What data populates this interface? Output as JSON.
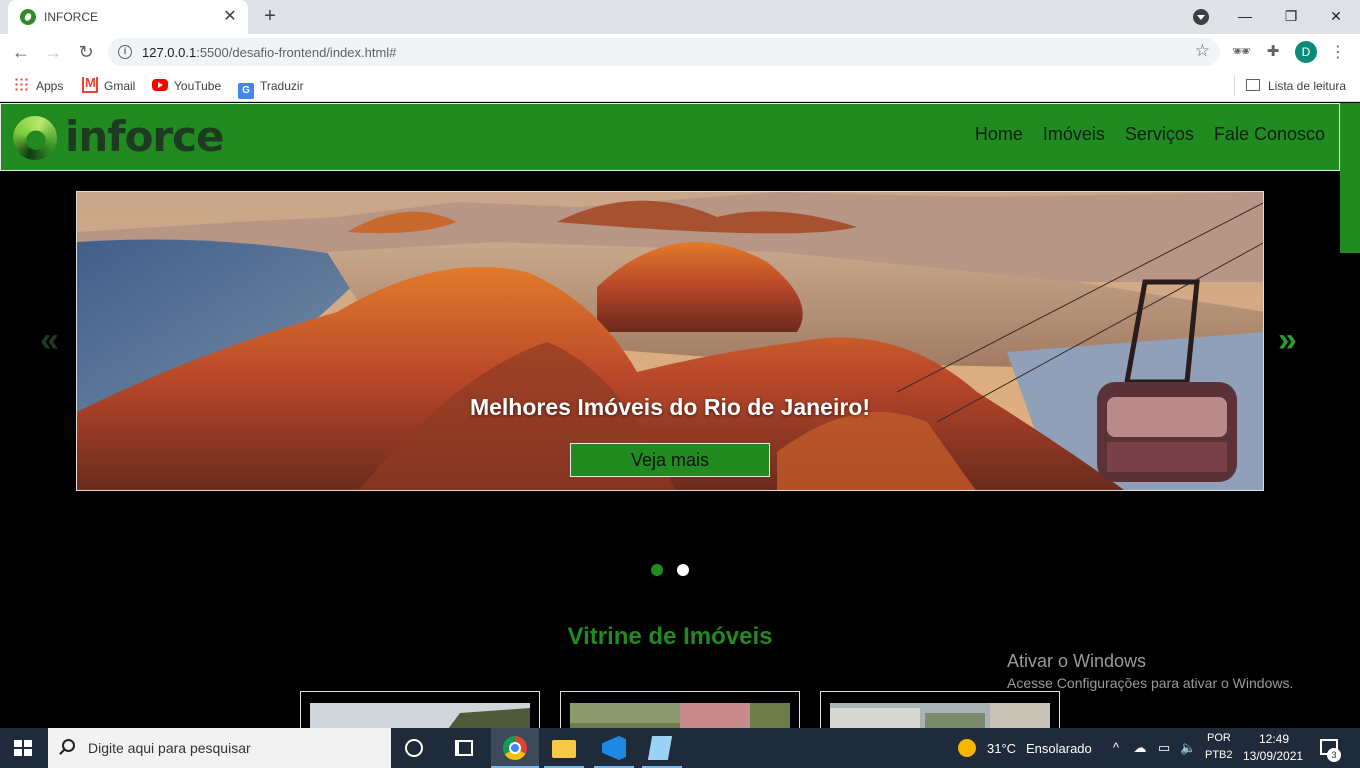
{
  "browser": {
    "tab_title": "INFORCE",
    "tab_close": "✕",
    "new_tab": "+",
    "url_host": "127.0.0.1",
    "url_path": ":5500/desafio-frontend/index.html#",
    "window_minimize": "—",
    "window_restore": "❐",
    "window_close": "✕",
    "profile_initial": "D",
    "bookmarks": [
      {
        "label": "Apps"
      },
      {
        "label": "Gmail"
      },
      {
        "label": "YouTube"
      },
      {
        "label": "Traduzir"
      }
    ],
    "reading_list": "Lista de leitura"
  },
  "site": {
    "logo_text": "inforce",
    "nav": [
      {
        "label": "Home"
      },
      {
        "label": "Imóveis"
      },
      {
        "label": "Serviços"
      },
      {
        "label": "Fale Conosco"
      }
    ],
    "carousel": {
      "caption": "Melhores Imóveis do Rio de Janeiro!",
      "button": "Veja mais",
      "prev": "«",
      "next": "»",
      "slides": 2,
      "active_slide": 1
    },
    "section_title": "Vitrine de Imóveis",
    "cards": 3
  },
  "windows_watermark": {
    "title": "Ativar o Windows",
    "subtitle": "Acesse Configurações para ativar o Windows."
  },
  "taskbar": {
    "search_placeholder": "Digite aqui para pesquisar",
    "temperature": "31°C",
    "weather": "Ensolarado",
    "lang_top": "POR",
    "lang_bottom": "PTB2",
    "time": "12:49",
    "date": "13/09/2021",
    "notifications": "3"
  },
  "colors": {
    "brand_green": "#218a21",
    "page_bg": "#000000",
    "taskbar_bg": "#1f2b3a"
  }
}
